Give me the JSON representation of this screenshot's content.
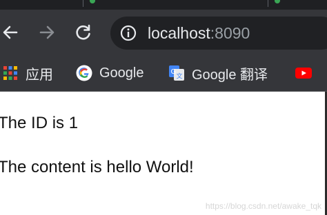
{
  "toolbar": {
    "back_icon": "arrow-left-icon",
    "forward_icon": "arrow-right-icon",
    "reload_icon": "reload-icon",
    "address": {
      "info_icon": "info-icon",
      "host": "localhost",
      "port": ":8090"
    }
  },
  "bookmarks": {
    "items": [
      {
        "label": "应用",
        "icon": "apps-grid-icon"
      },
      {
        "label": "Google",
        "icon": "google-icon"
      },
      {
        "label": "Google 翻译",
        "icon": "google-translate-icon"
      },
      {
        "label": "",
        "icon": "youtube-icon"
      }
    ]
  },
  "page": {
    "lines": [
      "The ID is 1",
      "The content is hello World!"
    ]
  },
  "watermark": "https://blog.csdn.net/awake_tqk",
  "colors": {
    "toolbar_bg": "#35363a",
    "omnibox_bg": "#202124",
    "text_light": "#e8eaed",
    "text_muted": "#9aa0a6"
  }
}
